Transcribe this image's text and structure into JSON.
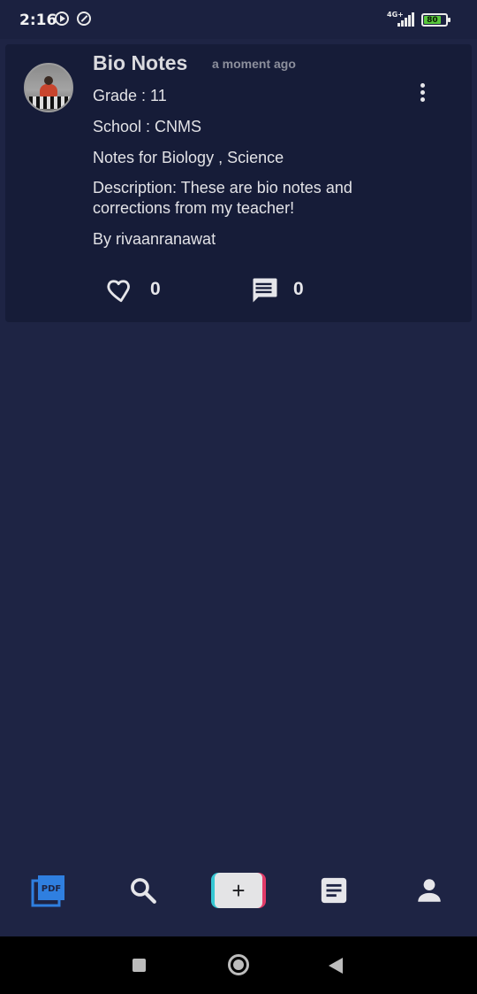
{
  "status_bar": {
    "time": "2:16",
    "network": "4G+",
    "battery": "80",
    "battery_level": 0.8
  },
  "post": {
    "title": "Bio Notes",
    "timestamp": "a moment ago",
    "grade": "Grade : 11",
    "school": "School : CNMS",
    "subjects": "Notes for Biology , Science",
    "description": "Description: These are bio notes and corrections from my teacher!",
    "author": "By rivaanranawat",
    "likes": "0",
    "comments": "0"
  },
  "bottom_nav": {
    "pdf_icon_text": "PDF",
    "add_label": "+",
    "active_color": "#2f7fe0",
    "inactive_color": "#e6e6ea"
  }
}
